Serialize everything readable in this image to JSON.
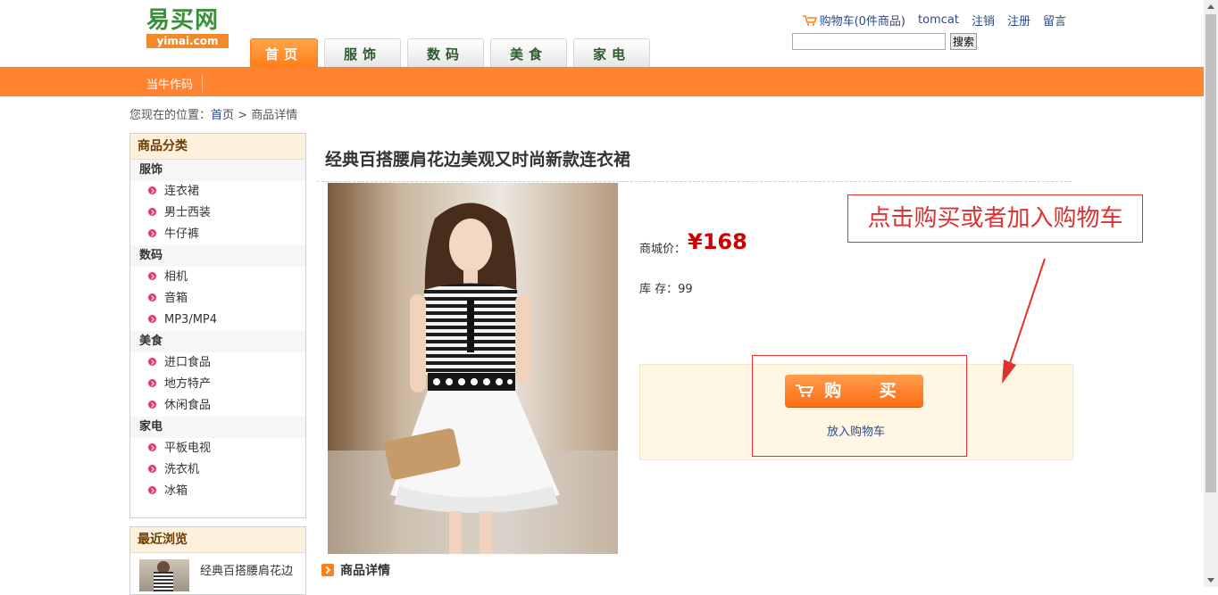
{
  "logo": {
    "cn": "易买网",
    "en": "yimai.com"
  },
  "tabs": [
    {
      "label": "首页"
    },
    {
      "label": "服饰"
    },
    {
      "label": "数码"
    },
    {
      "label": "美食"
    },
    {
      "label": "家电"
    }
  ],
  "topnav": {
    "cart": "购物车(0件商品)",
    "user": "tomcat",
    "logout": "注销",
    "register": "注册",
    "message": "留言"
  },
  "search": {
    "value": "",
    "button": "搜索"
  },
  "subnav": {
    "item": "当牛作码"
  },
  "breadcrumb": {
    "prefix": "您现在的位置：",
    "home": "首页",
    "sep": ">",
    "current": "商品详情"
  },
  "sidebar": {
    "title": "商品分类",
    "groups": [
      {
        "name": "服饰",
        "items": [
          "连衣裙",
          "男士西装",
          "牛仔裤"
        ]
      },
      {
        "name": "数码",
        "items": [
          "相机",
          "音箱",
          "MP3/MP4"
        ]
      },
      {
        "name": "美食",
        "items": [
          "进口食品",
          "地方特产",
          "休闲食品"
        ]
      },
      {
        "name": "家电",
        "items": [
          "平板电视",
          "洗衣机",
          "冰箱"
        ]
      }
    ],
    "recent_title": "最近浏览",
    "recent_item": "经典百搭腰肩花边"
  },
  "product": {
    "title": "经典百搭腰肩花边美观又时尚新款连衣裙",
    "price_label": "商城价：",
    "price": "¥168",
    "stock": "库 存：99",
    "buy_label": "购 买",
    "add_cart": "放入购物车",
    "detail_title": "商品详情"
  },
  "annotation": {
    "tip": "点击购买或者加入购物车"
  },
  "colors": {
    "accent": "#ff8330",
    "price": "#cc0000",
    "annotation": "#e03030"
  }
}
